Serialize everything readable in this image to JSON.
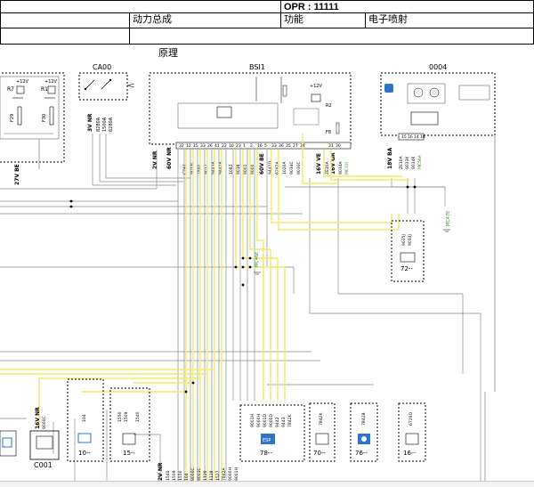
{
  "header": {
    "opr": "OPR : 11111",
    "category": "动力总成",
    "function_label": "功能",
    "function_value": "电子喷射",
    "section": "原理"
  },
  "components": {
    "ca00": "CA00",
    "bsi1": "BSI1",
    "c0004": "0004",
    "c001": "C001",
    "n10": "10--",
    "n15": "15--",
    "n78": "78--",
    "n70": "70--",
    "n76": "76--",
    "n16": "16--",
    "n72": "72--"
  },
  "labels": {
    "r7": "R7",
    "r1": "R1",
    "f29": "F29",
    "f30": "F30",
    "v12_a": "+12V",
    "v12_b": "+12V",
    "v12_c": "+12V",
    "w27vbe": "27V BE",
    "w3vnr": "3V NR",
    "w2vnr": "2V NR",
    "w60vnr": "60V NR",
    "w60vbe": "60V BE",
    "w16vve": "16V VE",
    "w16vgr": "16V GR",
    "w18vba": "18V BA",
    "w16vnr": "16V NR",
    "w2vnr_b": "2V NR",
    "mc_a": "MC46E",
    "mc_b": "MC47E",
    "esp": "ESP",
    "f8": "F8",
    "r2": "R2"
  },
  "colors": {
    "yellow_wire": "#f1e96a",
    "gray_wire": "#8a8a8a",
    "blue_accent": "#2f74c8",
    "green_accent": "#3a8a3a"
  }
}
